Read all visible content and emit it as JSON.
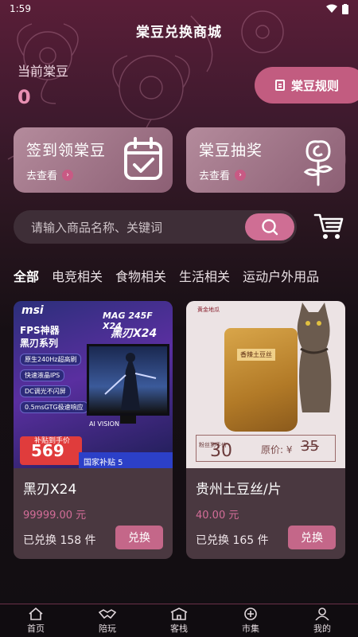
{
  "status_bar": {
    "time": "1:59"
  },
  "header": {
    "title": "棠豆兑换商城"
  },
  "balance": {
    "label": "当前棠豆",
    "value": "0"
  },
  "rules_button": {
    "label": "棠豆规则"
  },
  "feature_cards": [
    {
      "title": "签到领棠豆",
      "link": "去查看",
      "icon": "calendar-check-icon"
    },
    {
      "title": "棠豆抽奖",
      "link": "去查看",
      "icon": "rose-icon"
    }
  ],
  "search": {
    "placeholder": "请输入商品名称、关键词"
  },
  "tabs": [
    {
      "label": "全部",
      "active": true
    },
    {
      "label": "电竞相关"
    },
    {
      "label": "食物相关"
    },
    {
      "label": "生活相关"
    },
    {
      "label": "运动户外用品"
    }
  ],
  "products": [
    {
      "name": "黑刃X24",
      "price": "99999.00 元",
      "sold": "已兑换 158 件",
      "button": "兑换",
      "image": {
        "brand": "msi",
        "model": "MAG 245F X24",
        "model_cn": "黑刃X24",
        "headline1": "FPS神器",
        "headline2": "黑刃系列",
        "tags": [
          "原生240Hz超高刷",
          "快速液晶IPS",
          "DC调光不闪屏",
          "0.5msGTG极速响应"
        ],
        "promo_label": "补贴到手价",
        "promo_price": "569",
        "ai": "AI VISION",
        "bottom": "国家补贴 5"
      }
    },
    {
      "name": "贵州土豆丝/片",
      "price": "40.00 元",
      "sold": "已兑换 165 件",
      "button": "兑换",
      "image": {
        "brand": "黄金地瓜",
        "bag_label": "香辣土豆丝",
        "price_label": "粉丝到手价",
        "price": "30",
        "orig_label": "原价: ¥",
        "orig": "35"
      }
    }
  ],
  "bottom_nav": [
    {
      "label": "首页",
      "icon": "home-icon"
    },
    {
      "label": "陪玩",
      "icon": "handshake-icon"
    },
    {
      "label": "客栈",
      "icon": "inn-icon"
    },
    {
      "label": "市集",
      "icon": "market-icon"
    },
    {
      "label": "我的",
      "icon": "profile-icon"
    }
  ],
  "colors": {
    "accent": "#c25c80",
    "price": "#d36d98",
    "card": "#4a3840"
  }
}
